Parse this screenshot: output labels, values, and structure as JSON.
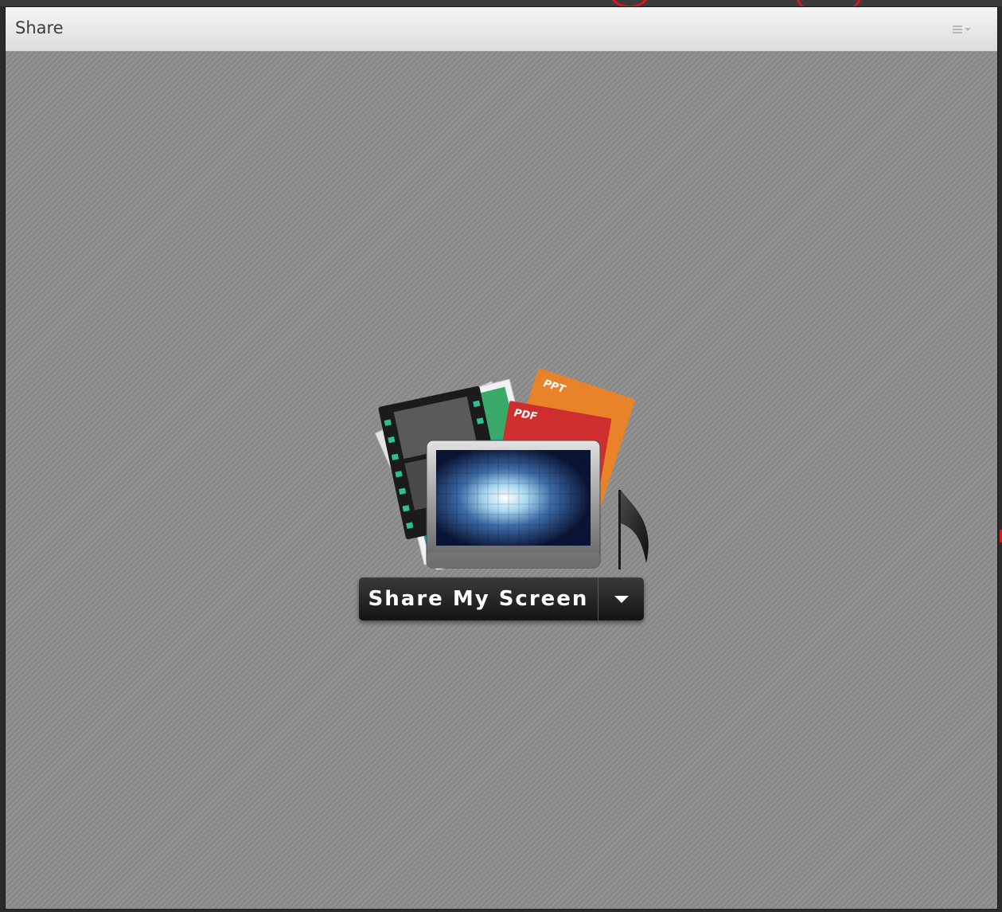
{
  "pod": {
    "title": "Share",
    "menu_icon": "pod-options-menu-icon"
  },
  "illustration": {
    "ppt_label": "PPT",
    "pdf_label": "PDF",
    "icons": [
      "film-strip-icon",
      "photo-icon",
      "ppt-document-icon",
      "pdf-document-icon",
      "screen-icon",
      "music-note-icon"
    ]
  },
  "share": {
    "button_label": "Share My Screen",
    "dropdown_icon": "chevron-down-icon"
  },
  "colors": {
    "ppt": "#e8832a",
    "pdf": "#cf2e2e",
    "annotation": "#e0141a",
    "button": "#1e1e1e",
    "background": "#8c8c8c"
  }
}
